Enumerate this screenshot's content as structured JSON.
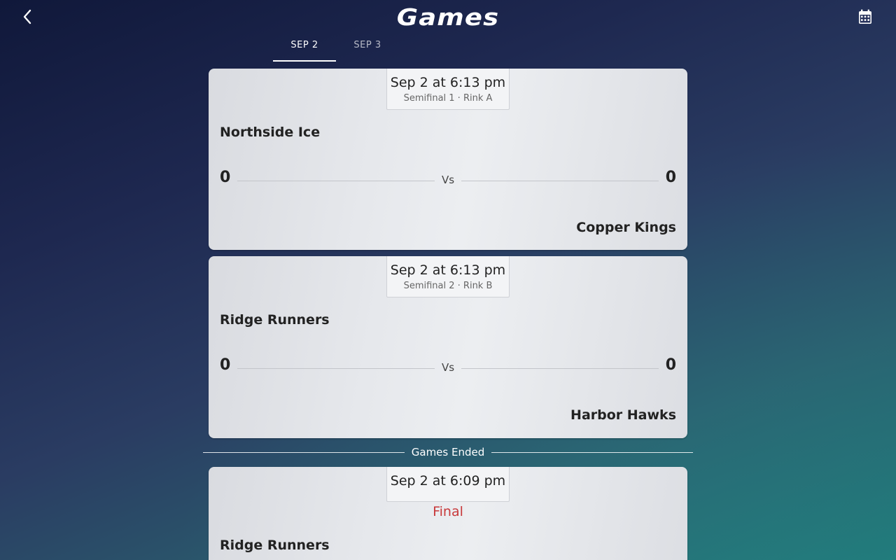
{
  "header": {
    "title": "Games",
    "back_icon": "chevron-left-icon",
    "calendar_icon": "calendar-icon"
  },
  "tabs": [
    {
      "label": "SEP 2",
      "active": true
    },
    {
      "label": "SEP 3",
      "active": false
    }
  ],
  "games": [
    {
      "datetime": "Sep 2 at 6:13 pm",
      "details": "Semifinal 1 · Rink A",
      "home_team": "Northside Ice",
      "away_team": "Copper Kings",
      "home_score": "0",
      "away_score": "0",
      "vs": "Vs"
    },
    {
      "datetime": "Sep 2 at 6:13 pm",
      "details": "Semifinal 2 · Rink B",
      "home_team": "Ridge Runners",
      "away_team": "Harbor Hawks",
      "home_score": "0",
      "away_score": "0",
      "vs": "Vs"
    }
  ],
  "ended_section": {
    "label": "Games Ended"
  },
  "ended_games": [
    {
      "datetime": "Sep 2 at 6:09 pm",
      "status": "Final",
      "home_team": "Ridge Runners"
    }
  ],
  "colors": {
    "final_status": "#c8393b",
    "background_top": "#10183a",
    "background_bottom": "#1f7676"
  }
}
